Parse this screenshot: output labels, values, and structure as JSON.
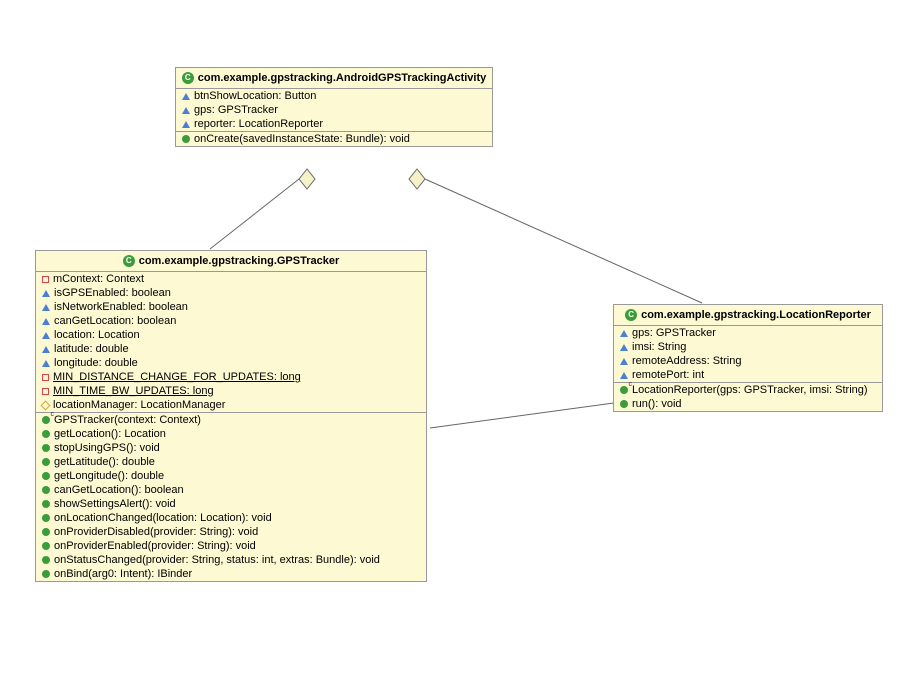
{
  "classes": {
    "activity": {
      "name": "com.example.gpstracking.AndroidGPSTrackingActivity",
      "fields": [
        "btnShowLocation: Button",
        "gps: GPSTracker",
        "reporter: LocationReporter"
      ],
      "methods": [
        "onCreate(savedInstanceState: Bundle): void"
      ]
    },
    "tracker": {
      "name": "com.example.gpstracking.GPSTracker",
      "priv_fields": [
        "mContext: Context"
      ],
      "pkg_fields": [
        "isGPSEnabled: boolean",
        "isNetworkEnabled: boolean",
        "canGetLocation: boolean",
        "location: Location",
        "latitude: double",
        "longitude: double"
      ],
      "static_priv": [
        "MIN_DISTANCE_CHANGE_FOR_UPDATES: long",
        "MIN_TIME_BW_UPDATES: long"
      ],
      "prot_fields": [
        "locationManager: LocationManager"
      ],
      "constructor": "GPSTracker(context: Context)",
      "methods": [
        "getLocation(): Location",
        "stopUsingGPS(): void",
        "getLatitude(): double",
        "getLongitude(): double",
        "canGetLocation(): boolean",
        "showSettingsAlert(): void",
        "onLocationChanged(location: Location): void",
        "onProviderDisabled(provider: String): void",
        "onProviderEnabled(provider: String): void",
        "onStatusChanged(provider: String, status: int, extras: Bundle): void",
        "onBind(arg0: Intent): IBinder"
      ]
    },
    "reporter": {
      "name": "com.example.gpstracking.LocationReporter",
      "pkg_fields": [
        "gps: GPSTracker",
        "imsi: String",
        "remoteAddress: String",
        "remotePort: int"
      ],
      "constructor": "LocationReporter(gps: GPSTracker, imsi: String)",
      "methods": [
        "run(): void"
      ]
    }
  }
}
